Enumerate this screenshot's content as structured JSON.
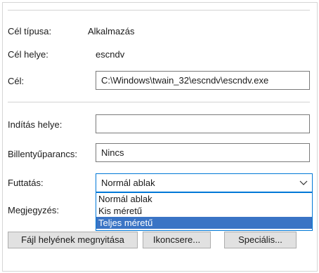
{
  "target_type": {
    "label": "Cél típusa:",
    "value": "Alkalmazás"
  },
  "target_location": {
    "label": "Cél helye:",
    "value": "escndv"
  },
  "target": {
    "label": "Cél:",
    "value": "C:\\Windows\\twain_32\\escndv\\escndv.exe"
  },
  "start_in": {
    "label": "Indítás helye:",
    "value": ""
  },
  "shortcut_key": {
    "label": "Billentyűparancs:",
    "value": "Nincs"
  },
  "run": {
    "label": "Futtatás:",
    "value": "Normál ablak",
    "options": [
      "Normál ablak",
      "Kis méretű",
      "Teljes méretű"
    ],
    "highlighted_option": "Teljes méretű"
  },
  "comment": {
    "label": "Megjegyzés:"
  },
  "buttons": {
    "open_location": "Fájl helyének megnyitása",
    "change_icon": "Ikoncsere...",
    "advanced": "Speciális..."
  },
  "colors": {
    "accent": "#0078d7",
    "selection": "#3a74c5",
    "button_face": "#e1e1e1"
  }
}
